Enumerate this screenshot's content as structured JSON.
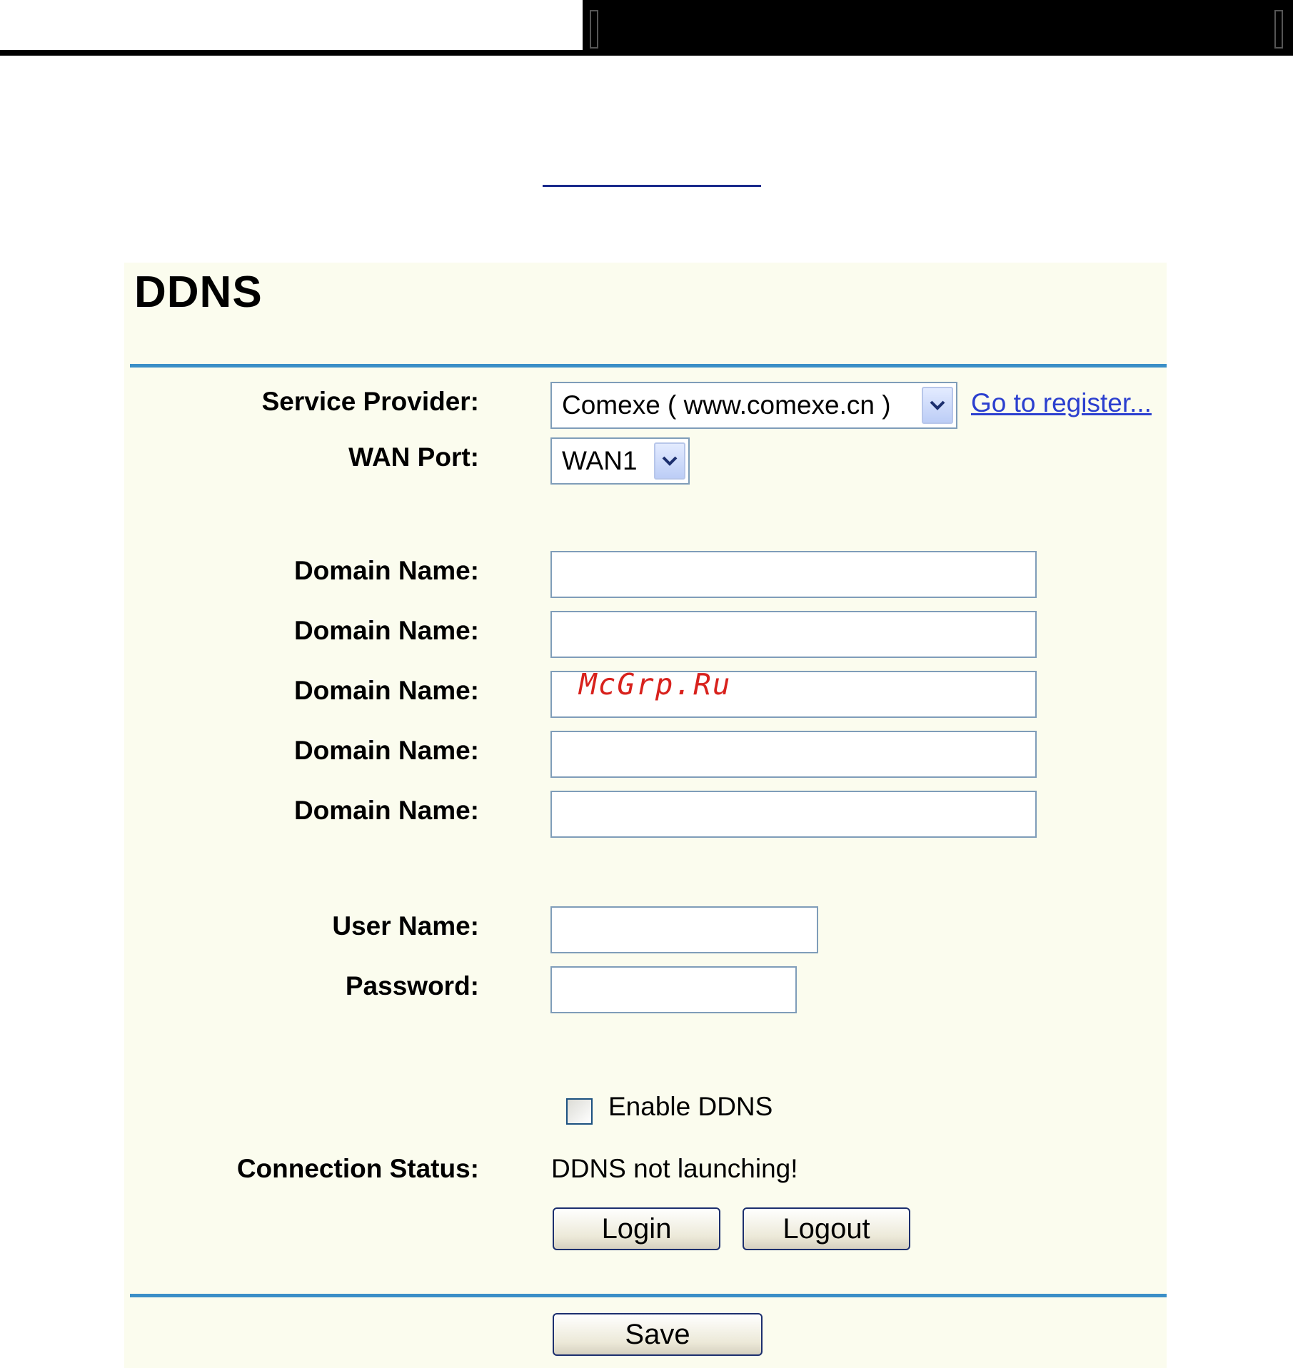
{
  "page": {
    "title": "DDNS"
  },
  "form": {
    "service_provider": {
      "label": "Service Provider:",
      "value": "Comexe ( www.comexe.cn )",
      "register_link": "Go to register..."
    },
    "wan_port": {
      "label": "WAN Port:",
      "value": "WAN1"
    },
    "domain_names": [
      {
        "label": "Domain Name:",
        "value": ""
      },
      {
        "label": "Domain Name:",
        "value": ""
      },
      {
        "label": "Domain Name:",
        "value": ""
      },
      {
        "label": "Domain Name:",
        "value": ""
      },
      {
        "label": "Domain Name:",
        "value": ""
      }
    ],
    "user_name": {
      "label": "User Name:",
      "value": ""
    },
    "password": {
      "label": "Password:",
      "value": ""
    },
    "enable_ddns": {
      "label": "Enable DDNS",
      "checked": false
    },
    "connection_status": {
      "label": "Connection Status:",
      "value": "DDNS not launching!"
    }
  },
  "buttons": {
    "login": "Login",
    "logout": "Logout",
    "save": "Save"
  },
  "watermark": "McGrp.Ru",
  "colors": {
    "panel_background": "#fbfcee",
    "rule": "#3b8fc7",
    "link": "#2b3fcf",
    "field_border": "#7f9db9",
    "watermark": "#d8221d"
  },
  "icons": {
    "dropdown_arrow": "chevron-down-icon",
    "checkbox": "checkbox-unchecked"
  }
}
